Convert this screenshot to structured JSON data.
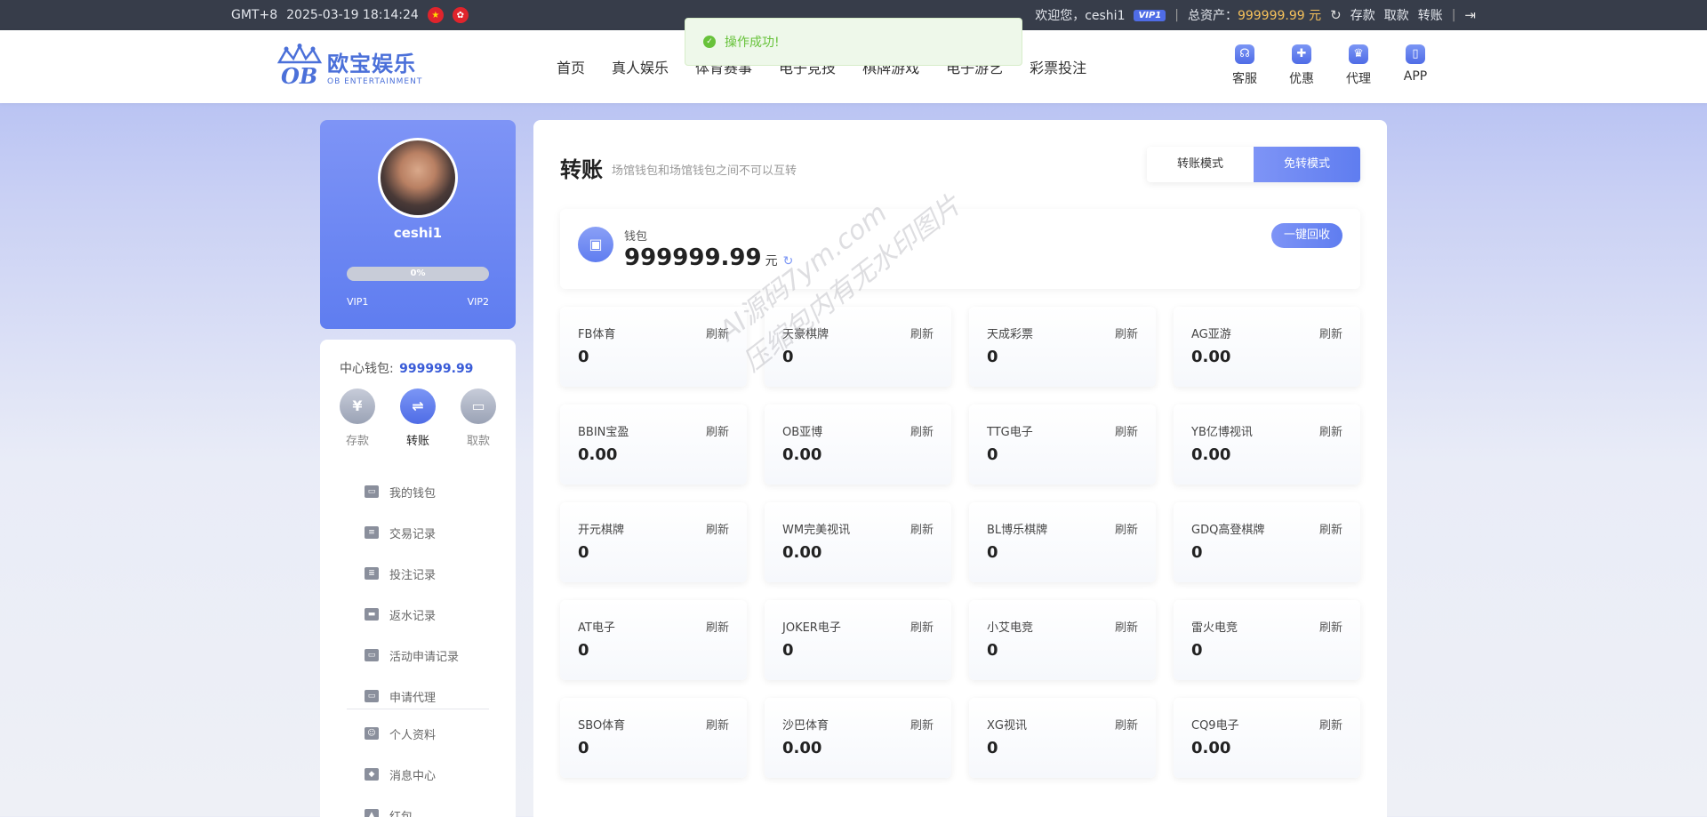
{
  "topbar": {
    "timezone": "GMT+8",
    "datetime": "2025-03-19 18:14:24",
    "welcome": "欢迎您，ceshi1",
    "vip_badge": "VIP1",
    "assets_label": "总资产：",
    "assets_value": "999999.99 元",
    "deposit": "存款",
    "withdraw": "取款",
    "transfer": "转账"
  },
  "header": {
    "logo_cn": "欧宝娱乐",
    "logo_en": "OB ENTERTAINMENT",
    "nav": [
      "首页",
      "真人娱乐",
      "体育赛事",
      "电子竞技",
      "棋牌游戏",
      "电子游艺",
      "彩票投注"
    ],
    "icons": [
      {
        "label": "客服",
        "icon": "headset-icon"
      },
      {
        "label": "优惠",
        "icon": "gift-icon"
      },
      {
        "label": "代理",
        "icon": "trophy-icon"
      },
      {
        "label": "APP",
        "icon": "phone-icon"
      }
    ]
  },
  "toast": {
    "message": "操作成功!"
  },
  "profile": {
    "username": "ceshi1",
    "progress_label": "0%",
    "progress": 0,
    "vip_from": "VIP1",
    "vip_to": "VIP2"
  },
  "sidebar": {
    "center_wallet_label": "中心钱包:",
    "center_wallet_value": "999999.99",
    "quick": [
      {
        "label": "存款",
        "glyph": "¥"
      },
      {
        "label": "转账",
        "glyph": "⇌"
      },
      {
        "label": "取款",
        "glyph": "▭"
      }
    ],
    "menu": [
      "我的钱包",
      "交易记录",
      "投注记录",
      "返水记录",
      "活动申请记录",
      "申请代理"
    ],
    "menu2": [
      "个人资料",
      "消息中心",
      "红包"
    ]
  },
  "main": {
    "title": "转账",
    "subtitle": "场馆钱包和场馆钱包之间不可以互转",
    "mode_transfer": "转账模式",
    "mode_free": "免转模式",
    "wallet_label": "钱包",
    "wallet_amount": "999999.99",
    "wallet_unit": "元",
    "recall_button": "一键回收",
    "refresh_label": "刷新",
    "venues": [
      {
        "name": "FB体育",
        "balance": "0"
      },
      {
        "name": "天豪棋牌",
        "balance": "0"
      },
      {
        "name": "天成彩票",
        "balance": "0"
      },
      {
        "name": "AG亚游",
        "balance": "0.00"
      },
      {
        "name": "BBIN宝盈",
        "balance": "0.00"
      },
      {
        "name": "OB亚博",
        "balance": "0.00"
      },
      {
        "name": "TTG电子",
        "balance": "0"
      },
      {
        "name": "YB亿博视讯",
        "balance": "0.00"
      },
      {
        "name": "开元棋牌",
        "balance": "0"
      },
      {
        "name": "WM完美视讯",
        "balance": "0.00"
      },
      {
        "name": "BL博乐棋牌",
        "balance": "0"
      },
      {
        "name": "GDQ高登棋牌",
        "balance": "0"
      },
      {
        "name": "AT电子",
        "balance": "0"
      },
      {
        "name": "JOKER电子",
        "balance": "0"
      },
      {
        "name": "小艾电竞",
        "balance": "0"
      },
      {
        "name": "雷火电竞",
        "balance": "0"
      },
      {
        "name": "SBO体育",
        "balance": "0"
      },
      {
        "name": "沙巴体育",
        "balance": "0.00"
      },
      {
        "name": "XG视讯",
        "balance": "0"
      },
      {
        "name": "CQ9电子",
        "balance": "0.00"
      }
    ]
  },
  "watermark": [
    "AI源码7ym.com",
    "压缩包内有无水印图片"
  ]
}
